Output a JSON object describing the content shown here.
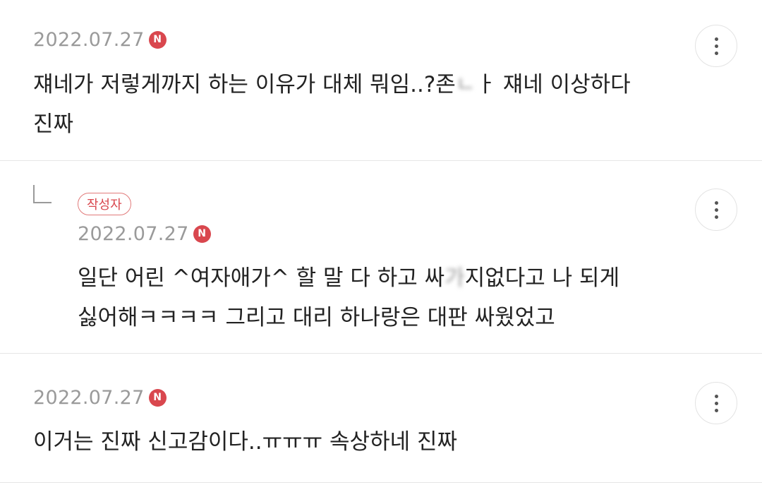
{
  "comments": [
    {
      "date": "2022.07.27",
      "badge": "N",
      "line1a": "쟤네가 저렇게까지 하는 이유가 대체 뭐임..?존",
      "line1blur": "ㄴ",
      "line1b": "ㅏ 쟤네 이상하다",
      "line2": "진짜"
    },
    {
      "author_badge": "작성자",
      "date": "2022.07.27",
      "badge": "N",
      "line1a": "일단 어린 ^여자애가^ 할 말 다 하고 싸",
      "line1blur": "가",
      "line1b": "지없다고 나 되게",
      "line2": "싫어해ㅋㅋㅋㅋ 그리고 대리 하나랑은 대판 싸웠었고"
    },
    {
      "date": "2022.07.27",
      "badge": "N",
      "line1": "이거는 진짜 신고감이다..ㅠㅠㅠ 속상하네 진짜"
    }
  ],
  "icons": {
    "more": "more-vertical-icon",
    "reply": "reply-arrow-icon",
    "new": "new-badge-icon"
  },
  "colors": {
    "badge": "#d9474e",
    "date": "#9a9a9a",
    "text": "#222222"
  }
}
